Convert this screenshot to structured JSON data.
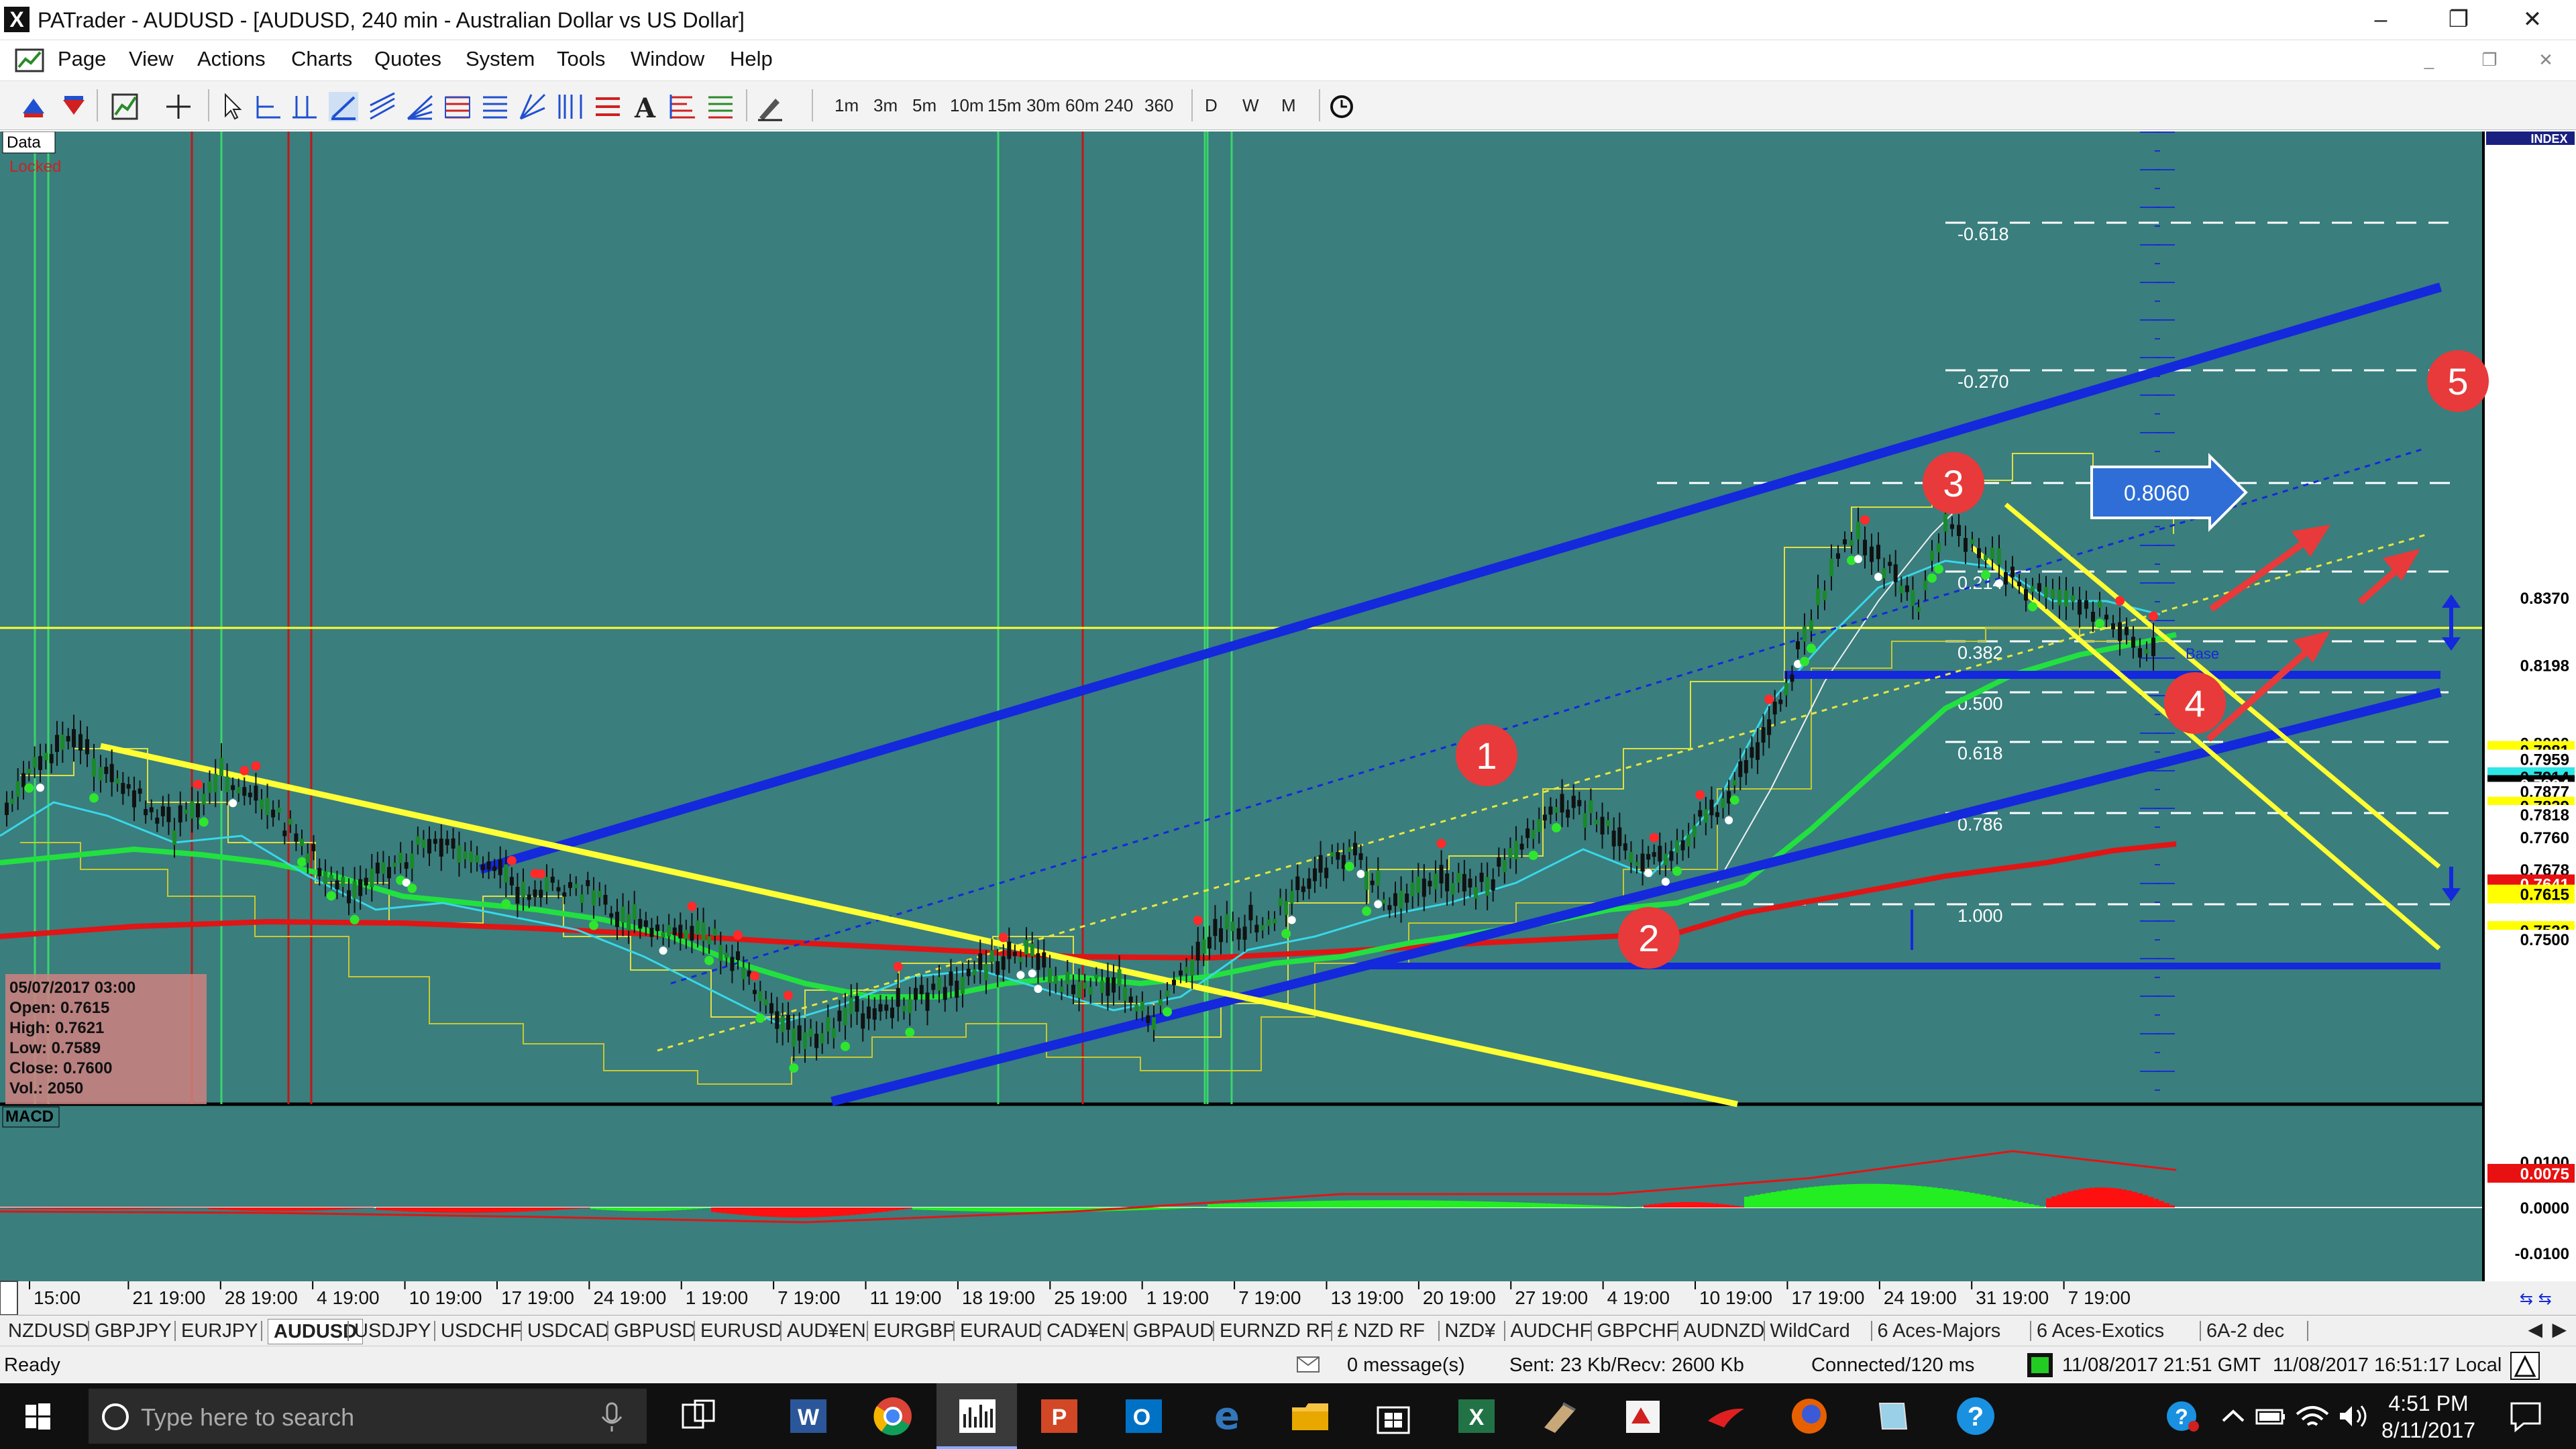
{
  "window": {
    "app_icon": "X",
    "title": "PATrader - AUDUSD - [AUDUSD, 240 min - Australian Dollar vs US Dollar]",
    "controls": {
      "minimize": "–",
      "restore": "❐",
      "close": "✕"
    }
  },
  "menu": {
    "items": [
      "Page",
      "View",
      "Actions",
      "Charts",
      "Quotes",
      "System",
      "Tools",
      "Window",
      "Help"
    ],
    "mdi": {
      "minimize": "_",
      "restore": "❐",
      "close": "✕"
    }
  },
  "toolbar": {
    "timeframes": [
      "1m",
      "3m",
      "5m",
      "10m",
      "15m",
      "30m",
      "60m",
      "240",
      "360"
    ],
    "periods": [
      "D",
      "W",
      "M"
    ]
  },
  "chart": {
    "data_label": "Data",
    "locked_label": "Locked",
    "index_label": "INDEX",
    "macd_label": "MACD",
    "ohlc": {
      "date": "05/07/2017 03:00",
      "open": "Open: 0.7615",
      "high": "High: 0.7621",
      "low": "Low: 0.7589",
      "close": "Close: 0.7600",
      "vol": "Vol.: 2050"
    },
    "fib_labels": [
      "-0.618",
      "-0.270",
      "0.214",
      "0.382",
      "0.500",
      "0.618",
      "0.786",
      "1.000"
    ],
    "annotations": {
      "n1": "1",
      "n2": "2",
      "n3": "3",
      "n4": "4",
      "n5": "5",
      "target": "0.8060",
      "base": "Base"
    },
    "price_labels": [
      {
        "text": "0.8370",
        "bg": "#ffffff",
        "fg": "#000000"
      },
      {
        "text": "0.8198",
        "bg": "#ffffff",
        "fg": "#000000"
      },
      {
        "text": "0.8000",
        "bg": "#ffffff",
        "fg": "#000000"
      },
      {
        "text": "0.7981",
        "bg": "#ffff00",
        "fg": "#000000"
      },
      {
        "text": "0.7959",
        "bg": "#ffffff",
        "fg": "#000000"
      },
      {
        "text": "0.7914",
        "bg": "#2ee6e6",
        "fg": "#000000"
      },
      {
        "text": "0.7894",
        "bg": "#000000",
        "fg": "#ffffff"
      },
      {
        "text": "0.7877",
        "bg": "#ffffff",
        "fg": "#000000"
      },
      {
        "text": "0.7839",
        "bg": "#ffff00",
        "fg": "#000000"
      },
      {
        "text": "0.7818",
        "bg": "#ffffff",
        "fg": "#000000"
      },
      {
        "text": "0.7760",
        "bg": "#ffffff",
        "fg": "#000000"
      },
      {
        "text": "0.7678",
        "bg": "#ffffff",
        "fg": "#000000"
      },
      {
        "text": "0.7641",
        "bg": "#e81010",
        "fg": "#ffffff"
      },
      {
        "text": "0.7615",
        "bg": "#ffff00",
        "fg": "#000000"
      },
      {
        "text": "0.7522",
        "bg": "#ffff00",
        "fg": "#000000"
      },
      {
        "text": "0.7500",
        "bg": "#ffffff",
        "fg": "#000000"
      }
    ],
    "macd_labels": [
      {
        "text": "0.0100",
        "bg": "#ffffff",
        "fg": "#000000"
      },
      {
        "text": "0.0075",
        "bg": "#e81010",
        "fg": "#ffffff"
      },
      {
        "text": "0.0000",
        "bg": "#ffffff",
        "fg": "#000000"
      },
      {
        "text": "-0.0100",
        "bg": "#ffffff",
        "fg": "#000000"
      }
    ],
    "x_labels": [
      "15:00",
      "21 19:00",
      "28 19:00",
      "4 19:00",
      "10 19:00",
      "17 19:00",
      "24 19:00",
      "1 19:00",
      "7 19:00",
      "11 19:00",
      "18 19:00",
      "25 19:00",
      "1 19:00",
      "7 19:00",
      "13 19:00",
      "20 19:00",
      "27 19:00",
      "4 19:00",
      "10 19:00",
      "17 19:00",
      "24 19:00",
      "31 19:00",
      "7 19:00"
    ],
    "colors": {
      "background": "#3a7e7e",
      "channel": "#1428dc",
      "trend": "#ffff33",
      "ma_red": "#e01515",
      "ma_green": "#22e040",
      "macd_green": "#22ee22",
      "macd_red": "#ff1010",
      "badge": "#e83a3a"
    }
  },
  "symbol_tabs": [
    "NZDUSD",
    "GBPJPY",
    "EURJPY",
    "AUDUSD",
    "USDJPY",
    "USDCHF",
    "USDCAD",
    "GBPUSD",
    "EURUSD",
    "AUD¥EN",
    "EURGBP",
    "EURAUD",
    "CAD¥EN",
    "GBPAUD",
    "EURNZD RF",
    "£ NZD RF",
    "NZD¥",
    "AUDCHF",
    "GBPCHF",
    "AUDNZD",
    "WildCard",
    "6 Aces-Majors",
    "6 Aces-Exotics",
    "6A-2 dec"
  ],
  "active_tab": "AUDUSD",
  "status": {
    "ready": "Ready",
    "messages": "0 message(s)",
    "traffic": "Sent: 23 Kb/Recv: 2600 Kb",
    "connection": "Connected/120 ms",
    "gmt": "11/08/2017 21:51 GMT",
    "local": "11/08/2017 16:51:17 Local"
  },
  "taskbar": {
    "search_placeholder": "Type here to search",
    "time": "4:51 PM",
    "date": "8/11/2017"
  }
}
